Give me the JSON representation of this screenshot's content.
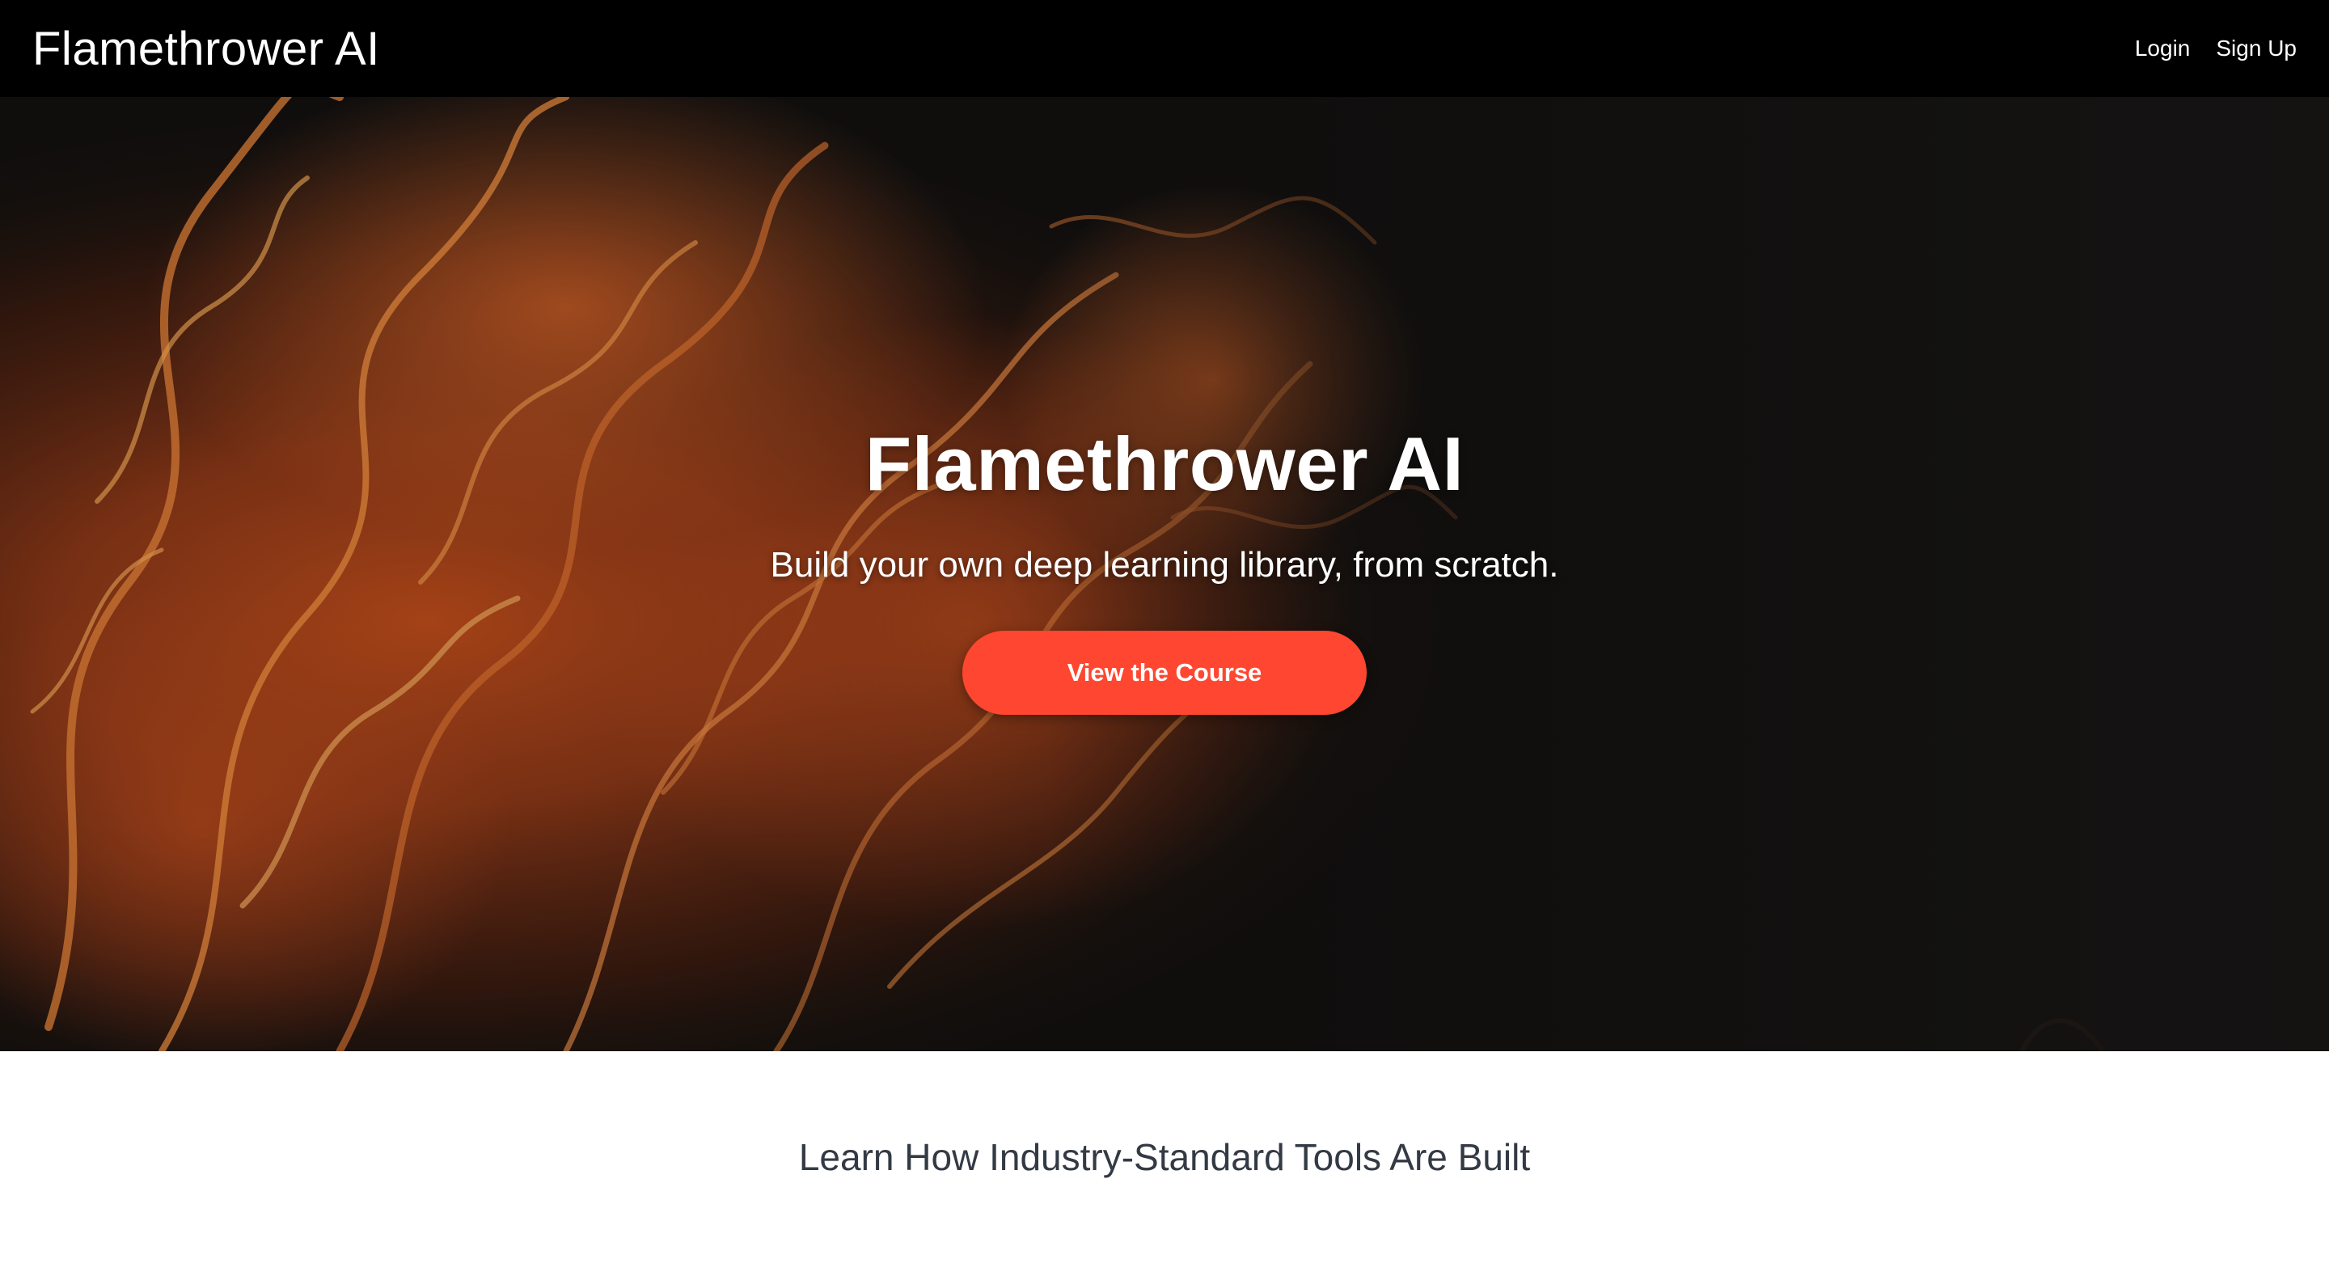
{
  "navbar": {
    "brand": "Flamethrower AI",
    "links": [
      "Login",
      "Sign Up"
    ]
  },
  "hero": {
    "title": "Flamethrower AI",
    "subtitle": "Build your own deep learning library, from scratch.",
    "cta_label": "View the Course",
    "background": "flames-photo"
  },
  "section": {
    "title": "Learn How Industry-Standard Tools Are Built"
  },
  "colors": {
    "navbar_bg": "#000000",
    "hero_bg": "#141211",
    "cta": "#ff4630",
    "section_title": "#333a44"
  }
}
